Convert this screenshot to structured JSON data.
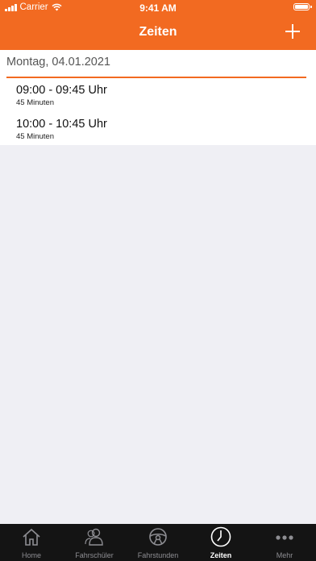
{
  "status_bar": {
    "carrier": "Carrier",
    "time": "9:41 AM"
  },
  "nav": {
    "title": "Zeiten"
  },
  "section": {
    "header": "Montag, 04.01.2021"
  },
  "entries": [
    {
      "time": "09:00 - 09:45 Uhr",
      "duration": "45 Minuten"
    },
    {
      "time": "10:00 - 10:45 Uhr",
      "duration": "45 Minuten"
    }
  ],
  "tabs": [
    {
      "label": "Home",
      "icon": "home-icon"
    },
    {
      "label": "Fahrschüler",
      "icon": "students-icon"
    },
    {
      "label": "Fahrstunden",
      "icon": "steering-wheel-icon"
    },
    {
      "label": "Zeiten",
      "icon": "clock-icon",
      "active": true
    },
    {
      "label": "Mehr",
      "icon": "more-dots-icon"
    }
  ],
  "colors": {
    "accent": "#F26A21",
    "background": "#EFEFF4",
    "tabbar": "#141414"
  }
}
